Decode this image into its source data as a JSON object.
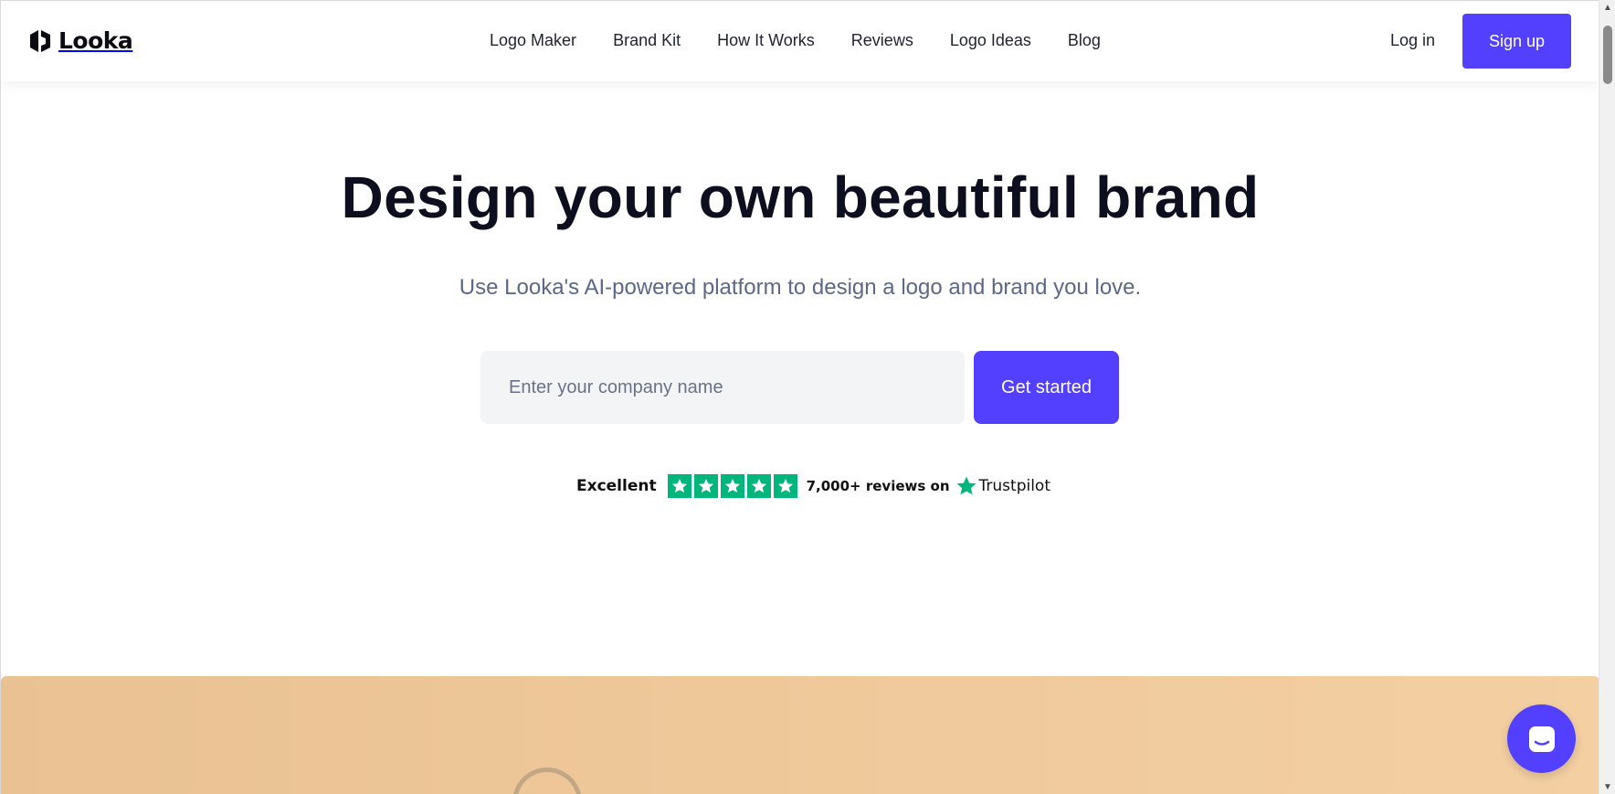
{
  "header": {
    "brand": "Looka",
    "nav": [
      "Logo Maker",
      "Brand Kit",
      "How It Works",
      "Reviews",
      "Logo Ideas",
      "Blog"
    ],
    "login": "Log in",
    "signup": "Sign up"
  },
  "hero": {
    "title": "Design your own beautiful brand",
    "subtitle": "Use Looka's AI-powered platform to design a logo and brand you love.",
    "input_placeholder": "Enter your company name",
    "input_value": "",
    "cta": "Get started"
  },
  "trustpilot": {
    "rating_word": "Excellent",
    "stars": 5,
    "reviews": "7,000+ reviews on",
    "brand": "Trustpilot"
  },
  "icons": {
    "logo": "looka-logo-icon",
    "star": "star-icon",
    "chat": "chat-icon",
    "scroll_up": "chevron-up-icon",
    "scroll_down": "chevron-down-icon"
  },
  "colors": {
    "primary": "#5340ff",
    "trustpilot_green": "#00b67a",
    "heading": "#0d0f1f",
    "subtitle": "#5d6786"
  }
}
